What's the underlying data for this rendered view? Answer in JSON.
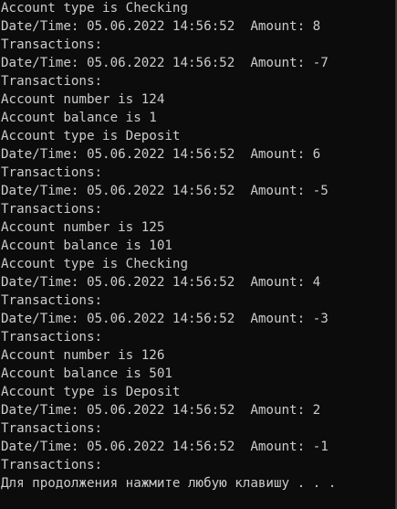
{
  "console": {
    "lines": [
      "Account type is Checking",
      "Date/Time: 05.06.2022 14:56:52  Amount: 8",
      "Transactions:",
      "Date/Time: 05.06.2022 14:56:52  Amount: -7",
      "Transactions:",
      "Account number is 124",
      "Account balance is 1",
      "Account type is Deposit",
      "Date/Time: 05.06.2022 14:56:52  Amount: 6",
      "Transactions:",
      "Date/Time: 05.06.2022 14:56:52  Amount: -5",
      "Transactions:",
      "Account number is 125",
      "Account balance is 101",
      "Account type is Checking",
      "Date/Time: 05.06.2022 14:56:52  Amount: 4",
      "Transactions:",
      "Date/Time: 05.06.2022 14:56:52  Amount: -3",
      "Transactions:",
      "Account number is 126",
      "Account balance is 501",
      "Account type is Deposit",
      "Date/Time: 05.06.2022 14:56:52  Amount: 2",
      "Transactions:",
      "Date/Time: 05.06.2022 14:56:52  Amount: -1",
      "Transactions:",
      "Для продолжения нажмите любую клавишу . . ."
    ]
  }
}
